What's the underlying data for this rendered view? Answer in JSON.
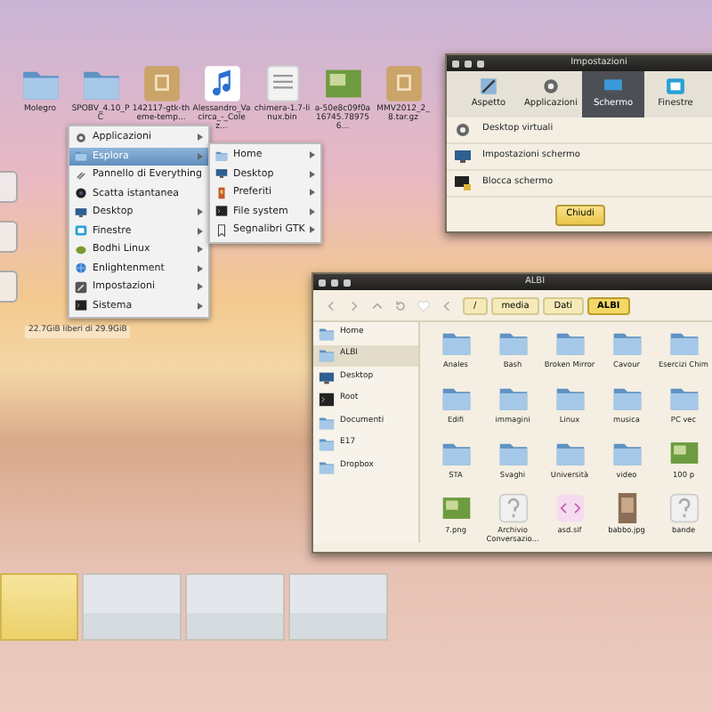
{
  "desktop_icons": [
    {
      "label": "Molegro",
      "kind": "folder"
    },
    {
      "label": "SPOBV_4.10_PC",
      "kind": "folder"
    },
    {
      "label": "142117-gtk-theme-temp...",
      "kind": "archive"
    },
    {
      "label": "Alessandro_Vacirca_-_Colez...",
      "kind": "music"
    },
    {
      "label": "chimera-1.7-linux.bin",
      "kind": "binary"
    },
    {
      "label": "a-50e8c09f0a16745.789756...",
      "kind": "image"
    },
    {
      "label": "MMV2012_2_8.tar.gz",
      "kind": "archive"
    }
  ],
  "disk_info": "22.7GiB liberi di 29.9GiB",
  "main_menu": [
    {
      "label": "Applicazioni",
      "kind": "gear",
      "submenu": true,
      "selected": false
    },
    {
      "label": "Esplora",
      "kind": "folder",
      "submenu": true,
      "selected": true
    },
    {
      "label": "Pannello di Everything",
      "kind": "link",
      "submenu": false,
      "selected": false
    },
    {
      "label": "Scatta istantanea",
      "kind": "camera",
      "submenu": false,
      "selected": false
    },
    {
      "label": "Desktop",
      "kind": "desktop",
      "submenu": true,
      "selected": false
    },
    {
      "label": "Finestre",
      "kind": "window",
      "submenu": true,
      "selected": false
    },
    {
      "label": "Bodhi Linux",
      "kind": "leaf",
      "submenu": true,
      "selected": false
    },
    {
      "label": "Enlightenment",
      "kind": "globe",
      "submenu": true,
      "selected": false
    },
    {
      "label": "Impostazioni",
      "kind": "wrench",
      "submenu": true,
      "selected": false
    },
    {
      "label": "Sistema",
      "kind": "terminal",
      "submenu": true,
      "selected": false
    }
  ],
  "explore_submenu": [
    {
      "label": "Home",
      "kind": "folder"
    },
    {
      "label": "Desktop",
      "kind": "desktop"
    },
    {
      "label": "Preferiti",
      "kind": "bookmark"
    },
    {
      "label": "File system",
      "kind": "terminal"
    },
    {
      "label": "Segnalibri GTK",
      "kind": "bookmark-outline"
    }
  ],
  "settings_window": {
    "title": "Impostazioni",
    "tabs": [
      {
        "label": "Aspetto",
        "kind": "paint",
        "selected": false
      },
      {
        "label": "Applicazioni",
        "kind": "gear",
        "selected": false
      },
      {
        "label": "Schermo",
        "kind": "screen",
        "selected": true
      },
      {
        "label": "Finestre",
        "kind": "window",
        "selected": false
      }
    ],
    "items": [
      {
        "label": "Desktop virtuali",
        "kind": "gear"
      },
      {
        "label": "Impostazioni schermo",
        "kind": "monitor"
      },
      {
        "label": "Blocca schermo",
        "kind": "lock"
      }
    ],
    "close_button": "Chiudi"
  },
  "file_manager": {
    "title": "ALBI",
    "path": [
      {
        "label": "/",
        "selected": false
      },
      {
        "label": "media",
        "selected": false
      },
      {
        "label": "Dati",
        "selected": false
      },
      {
        "label": "ALBI",
        "selected": true
      }
    ],
    "places": [
      {
        "label": "Home",
        "kind": "folder",
        "selected": false
      },
      {
        "label": "ALBI",
        "kind": "folder",
        "selected": true
      },
      {
        "label": "Desktop",
        "kind": "desktop",
        "selected": false
      },
      {
        "label": "Root",
        "kind": "terminal",
        "selected": false
      },
      {
        "label": "Documenti",
        "kind": "folder",
        "selected": false
      },
      {
        "label": "E17",
        "kind": "folder",
        "selected": false
      },
      {
        "label": "Dropbox",
        "kind": "folder",
        "selected": false
      }
    ],
    "files": [
      {
        "name": "Anales",
        "kind": "folder"
      },
      {
        "name": "Bash",
        "kind": "folder"
      },
      {
        "name": "Broken Mirror",
        "kind": "folder"
      },
      {
        "name": "Cavour",
        "kind": "folder"
      },
      {
        "name": "Esercizi Chim",
        "kind": "folder"
      },
      {
        "name": "Edifi",
        "kind": "folder"
      },
      {
        "name": "immagini",
        "kind": "folder"
      },
      {
        "name": "Linux",
        "kind": "folder"
      },
      {
        "name": "musica",
        "kind": "folder"
      },
      {
        "name": "PC vec",
        "kind": "folder"
      },
      {
        "name": "STA",
        "kind": "folder"
      },
      {
        "name": "Svaghi",
        "kind": "folder"
      },
      {
        "name": "Università",
        "kind": "folder"
      },
      {
        "name": "video",
        "kind": "folder"
      },
      {
        "name": "100 p",
        "kind": "image"
      },
      {
        "name": "7.png",
        "kind": "image"
      },
      {
        "name": "Archivio Conversazio...",
        "kind": "unknown"
      },
      {
        "name": "asd.sif",
        "kind": "code"
      },
      {
        "name": "babbo.jpg",
        "kind": "photo"
      },
      {
        "name": "bande",
        "kind": "unknown"
      }
    ]
  },
  "pager": [
    {
      "selected": true
    },
    {
      "selected": false
    },
    {
      "selected": false
    },
    {
      "selected": false
    }
  ]
}
